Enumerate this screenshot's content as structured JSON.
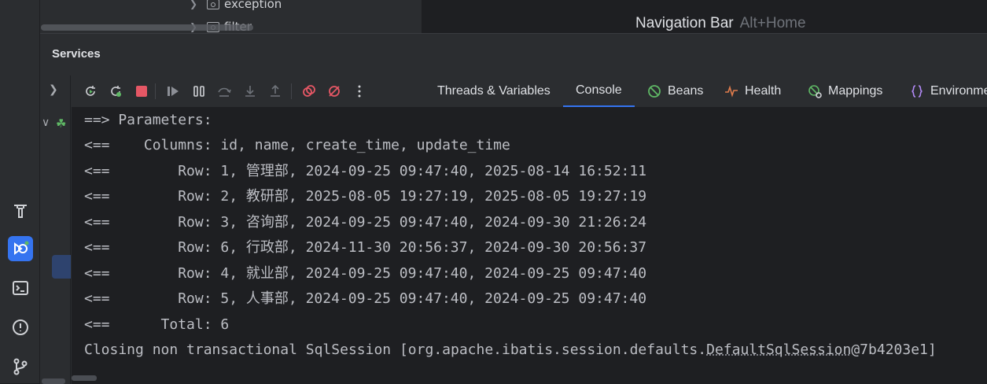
{
  "project_tree": {
    "items": [
      {
        "label": "exception",
        "expanded": false
      },
      {
        "label": "filter",
        "expanded": false
      }
    ]
  },
  "editor_hint": {
    "label": "Navigation Bar",
    "shortcut": "Alt+Home"
  },
  "services": {
    "title": "Services",
    "tabs": [
      {
        "label": "Threads & Variables",
        "icon": "none",
        "active": false
      },
      {
        "label": "Console",
        "icon": "none",
        "active": true
      },
      {
        "label": "Beans",
        "icon": "beans-icon",
        "active": false
      },
      {
        "label": "Health",
        "icon": "health-icon",
        "active": false
      },
      {
        "label": "Mappings",
        "icon": "mappings-icon",
        "active": false
      },
      {
        "label": "Environment",
        "icon": "environment-icon",
        "active": false
      }
    ],
    "toolbar_icons": [
      "rerun-icon",
      "rerun-debug-icon",
      "stop-icon",
      "resume-icon",
      "pause-icon",
      "step-over-icon",
      "step-into-icon",
      "step-out-icon",
      "view-breakpoints-icon",
      "mute-breakpoints-icon",
      "more-icon"
    ]
  },
  "console": {
    "lines": [
      "==> Parameters: ",
      "<==    Columns: id, name, create_time, update_time",
      "<==        Row: 1, 管理部, 2024-09-25 09:47:40, 2025-08-14 16:52:11",
      "<==        Row: 2, 教研部, 2025-08-05 19:27:19, 2025-08-05 19:27:19",
      "<==        Row: 3, 咨询部, 2024-09-25 09:47:40, 2024-09-30 21:26:24",
      "<==        Row: 6, 行政部, 2024-11-30 20:56:37, 2024-09-30 20:56:37",
      "<==        Row: 4, 就业部, 2024-09-25 09:47:40, 2024-09-25 09:47:40",
      "<==        Row: 5, 人事部, 2024-09-25 09:47:40, 2024-09-25 09:47:40",
      "<==      Total: 6"
    ],
    "closing": {
      "prefix": "Closing non transactional SqlSession [org.apache.ibatis.session.defaults.",
      "link": "DefaultSqlSession",
      "suffix": "@7b4203e1]"
    }
  },
  "colors": {
    "accent": "#3574f0",
    "stop": "#e55765",
    "run": "#5fb865",
    "breakpoint": "#e55765"
  }
}
